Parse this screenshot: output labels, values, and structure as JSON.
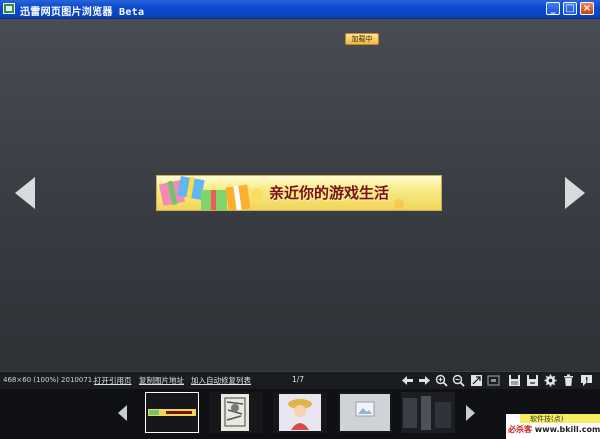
{
  "window": {
    "title": "迅雷网页图片浏览器 Beta",
    "controls": [
      "minimize-icon",
      "maximize-icon",
      "close-icon"
    ]
  },
  "viewer": {
    "banner_text": "亲近你的游戏生活",
    "prev_icon": "arrow-left-icon",
    "next_icon": "arrow-right-icon"
  },
  "statusbar": {
    "info": "468×60 (100%)  2010071...",
    "links": {
      "open_ref": "打开引用页",
      "copy_url": "复制图片地址",
      "add_auto_fix": "加入自动修复列表"
    },
    "page": "1/7",
    "tools": [
      "back-icon",
      "forward-icon",
      "zoom-in-icon",
      "zoom-out-icon",
      "fit-icon",
      "actual-size-icon",
      "save-icon",
      "save-as-icon",
      "settings-icon",
      "delete-icon",
      "info-icon"
    ]
  },
  "thumbnails": {
    "items": [
      {
        "kind": "banner",
        "selected": true
      },
      {
        "kind": "comic"
      },
      {
        "kind": "anime"
      },
      {
        "kind": "loading"
      },
      {
        "kind": "dark"
      }
    ],
    "loading_label": "加载中"
  },
  "watermark": {
    "top_text": "软件技(点)",
    "site_a": "必杀客",
    "site_b": "www.bkill.com"
  },
  "colors": {
    "titlebar": "#0846c6",
    "viewer_bg": "#3a3d43",
    "statusbar_bg": "#1a1c20",
    "banner_text": "#7a1010"
  }
}
